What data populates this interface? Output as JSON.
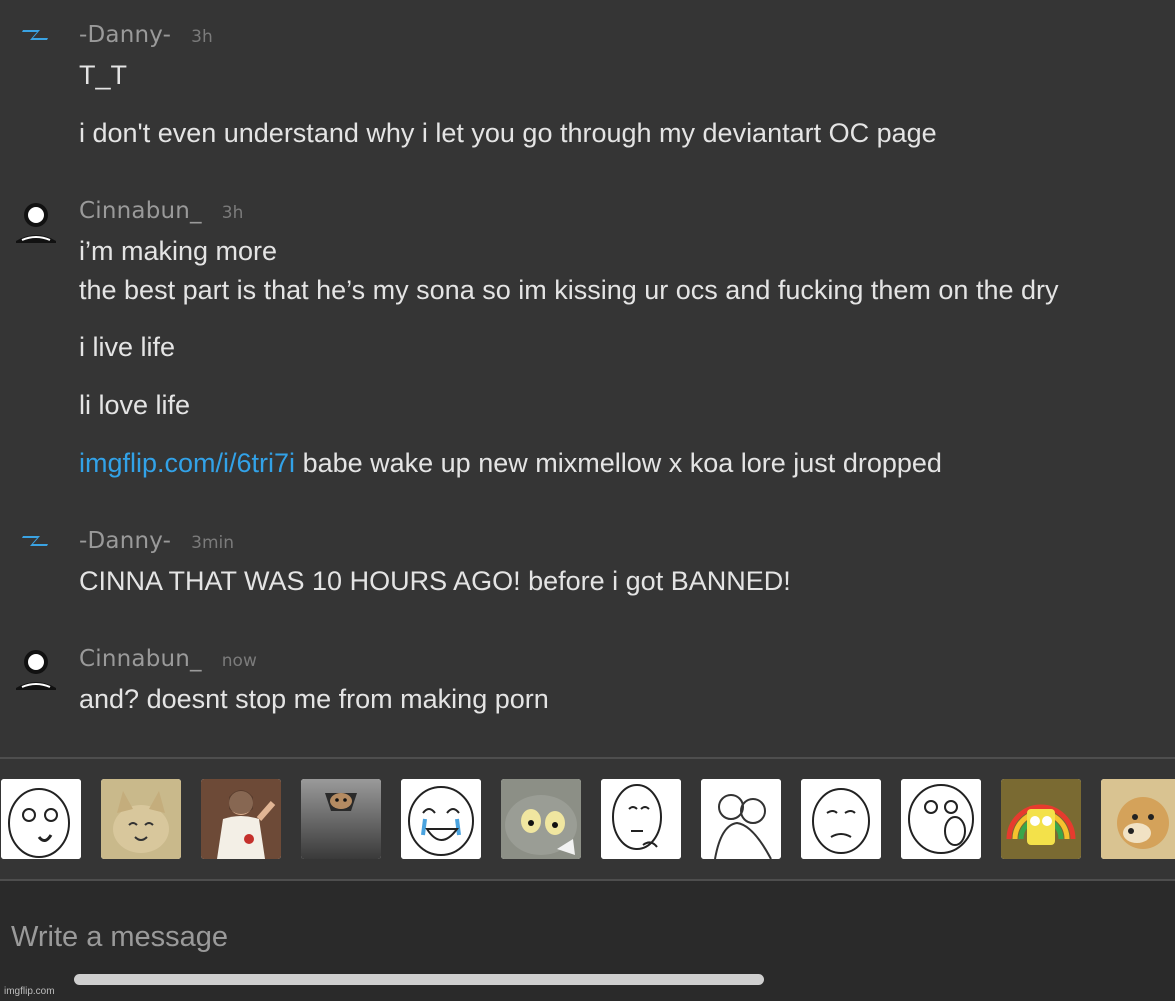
{
  "messages": [
    {
      "user": "-Danny-",
      "time": "3h",
      "avatar_icon": "lightning-bolt-icon",
      "lines": [
        "T_T",
        "i don't even understand why i let you go through my deviantart OC page"
      ]
    },
    {
      "user": "Cinnabun_",
      "time": "3h",
      "avatar_icon": "default-user-icon",
      "lines": [
        "i’m making more",
        "the best part is that he’s my sona so im kissing ur ocs and fucking them on the dry",
        "i live life",
        "li love life"
      ],
      "link_line": {
        "link": "imgflip.com/i/6tri7i",
        "text": " babe wake up new mixmellow x koa lore just dropped"
      }
    },
    {
      "user": "-Danny-",
      "time": "3min",
      "avatar_icon": "lightning-bolt-icon",
      "lines": [
        "CINNA THAT WAS 10 HOURS AGO! before i got BANNED!"
      ]
    },
    {
      "user": "Cinnabun_",
      "time": "now",
      "avatar_icon": "default-user-icon",
      "lines": [
        "and? doesnt stop me from making porn"
      ]
    }
  ],
  "meme_picker": [
    "rage-face-smirk-icon",
    "happy-cat-icon",
    "buddy-christ-icon",
    "ceiling-cat-icon",
    "tears-of-joy-rage-face-icon",
    "unsettled-tom-icon",
    "hmm-rage-face-icon",
    "i-know-that-feel-bro-icon",
    "okay-face-icon",
    "lol-face-icon",
    "imagination-spongebob-icon",
    "doge-icon"
  ],
  "composer": {
    "placeholder": "Write a message"
  },
  "watermark": "imgflip.com",
  "colors": {
    "background": "#353535",
    "link": "#32a2e8",
    "username": "#9a9a9a",
    "composer_bg": "#2a2a2a"
  }
}
